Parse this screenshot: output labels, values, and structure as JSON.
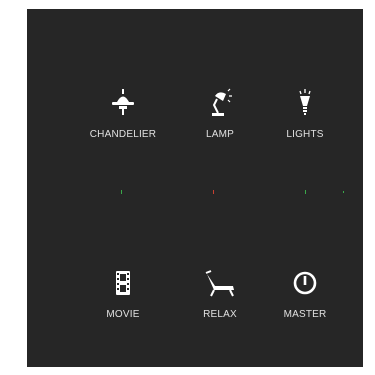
{
  "scenes": {
    "chandelier": {
      "label": "CHANDELIER",
      "icon": "chandelier-icon"
    },
    "lamp": {
      "label": "LAMP",
      "icon": "desk-lamp-icon"
    },
    "lights": {
      "label": "LIGHTS",
      "icon": "light-bulb-icon"
    },
    "movie": {
      "label": "MOVIE",
      "icon": "film-strip-icon"
    },
    "relax": {
      "label": "RELAX",
      "icon": "lounge-chair-icon"
    },
    "master": {
      "label": "MASTER",
      "icon": "power-icon"
    }
  },
  "colors": {
    "panel_bg": "#262626",
    "text": "#e0e0e0",
    "icon": "#ffffff",
    "indicator_green": "#3aa84a",
    "indicator_red": "#c84030"
  }
}
